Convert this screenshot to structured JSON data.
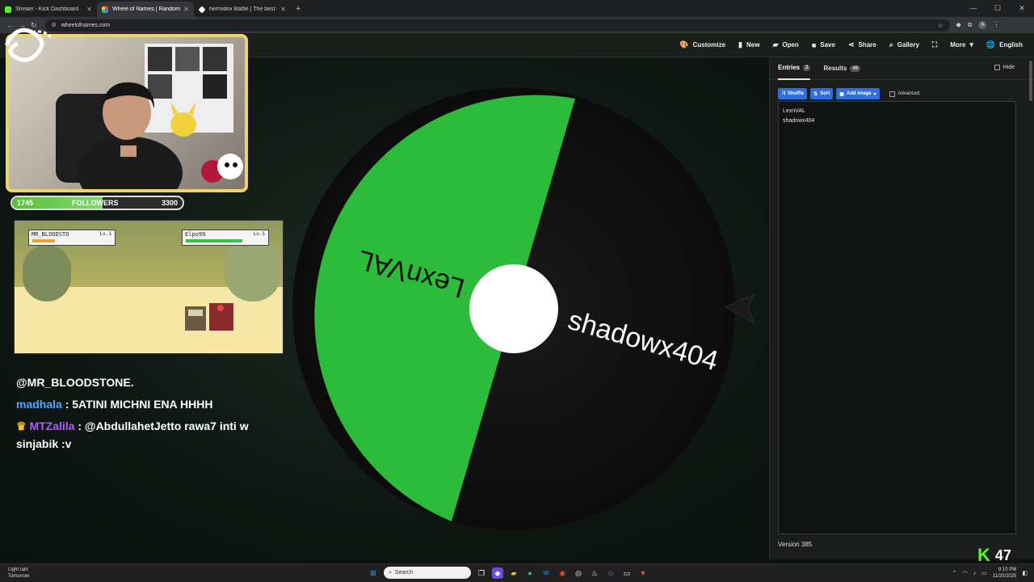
{
  "browser": {
    "tabs": [
      {
        "title": "Stream - Kick Dashboard",
        "color": "#53fc18"
      },
      {
        "title": "Wheel of Names | Random nam",
        "color": "#e84d3d"
      },
      {
        "title": "hermidox Battle | The best Cha",
        "color": "#ffffff"
      }
    ],
    "url": "wheelofnames.com"
  },
  "toolbar": {
    "customize": "Customize",
    "new": "New",
    "open": "Open",
    "save": "Save",
    "share": "Share",
    "gallery": "Gallery",
    "more": "More",
    "language": "English"
  },
  "wheel": {
    "segments": [
      {
        "label": "LexnVAL",
        "color": "#2dbb3c"
      },
      {
        "label": "shadowx404",
        "color": "#111111"
      }
    ]
  },
  "panel": {
    "tabs": [
      {
        "label": "Entries",
        "count": "2"
      },
      {
        "label": "Results",
        "count": "49"
      }
    ],
    "hide_label": "Hide",
    "shuffle": "Shuffle",
    "sort": "Sort",
    "add_image": "Add image",
    "advanced": "Advanced",
    "entries": [
      "LexnVAL",
      "shadowx404"
    ],
    "version": "Version 385"
  },
  "overlay": {
    "follow_current": "1745",
    "follow_label": "FOLLOWERS",
    "follow_goal": "3300",
    "follow_progress": 0.53,
    "game_player": "MR_BLOODSTO",
    "game_player_level": "Lv.1",
    "game_enemy": "Elpo99",
    "game_enemy_level": "Lv.5",
    "chat": [
      {
        "user": "",
        "text": "@MR_BLOODSTONE."
      },
      {
        "user": "madhala",
        "text": ": 5ATINI MICHNI ENA HHHH"
      },
      {
        "user": "MTZalila",
        "text": ": @AbdullahetJetto rawa7 inti w sinjabik :v"
      }
    ],
    "viewer_count": "47"
  },
  "taskbar": {
    "weather_line1": "Light rain",
    "weather_line2": "Tomorrow",
    "search_placeholder": "Search",
    "time": "9:10 PM",
    "date": "11/25/2025"
  }
}
